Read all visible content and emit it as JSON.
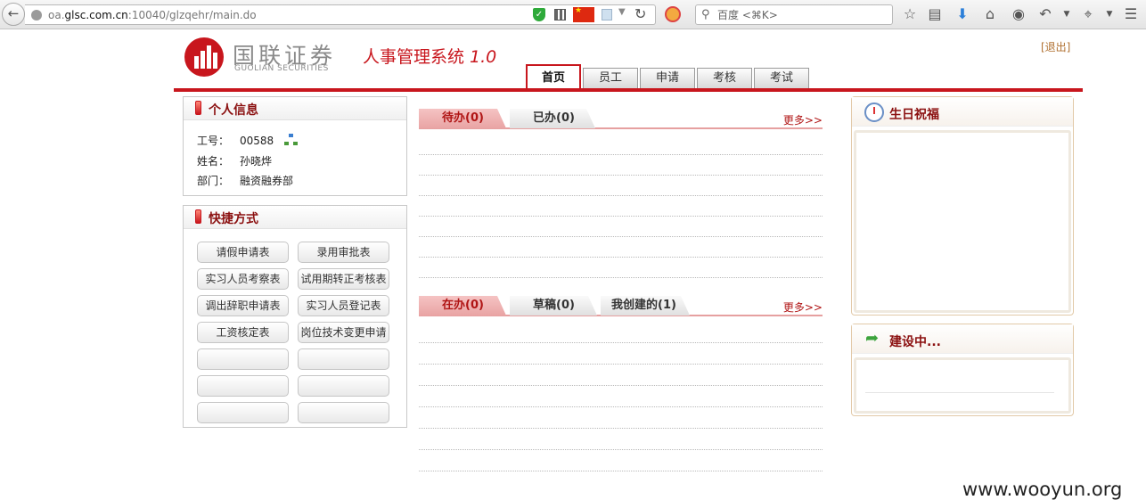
{
  "browser": {
    "url_prefix": "oa.",
    "url_domain": "glsc.com.cn",
    "url_suffix": ":10040/glzqehr/main.do",
    "search_placeholder": "百度 <⌘K>"
  },
  "header": {
    "logo_cn": "国联证券",
    "logo_en": "GUOLIAN SECURITIES",
    "system_title": "人事管理系统",
    "version": "1.0",
    "logout_label": "[退出]",
    "nav_tabs": [
      {
        "label": "首页",
        "active": true
      },
      {
        "label": "员工",
        "active": false
      },
      {
        "label": "申请",
        "active": false
      },
      {
        "label": "考核",
        "active": false
      },
      {
        "label": "考试",
        "active": false
      }
    ]
  },
  "personal_info": {
    "title": "个人信息",
    "rows": [
      {
        "label": "工号：",
        "value": "00588"
      },
      {
        "label": "姓名：",
        "value": "孙晓烨"
      },
      {
        "label": "部门：",
        "value": "融资融券部"
      }
    ]
  },
  "shortcuts": {
    "title": "快捷方式",
    "buttons": [
      "请假申请表",
      "录用审批表",
      "实习人员考察表",
      "试用期转正考核表",
      "调出辞职申请表",
      "实习人员登记表",
      "工资核定表",
      "岗位技术变更申请",
      "",
      "",
      "",
      "",
      "",
      ""
    ]
  },
  "tasks_top": {
    "tabs": [
      "待办(0)",
      "已办(0)"
    ],
    "more_label": "更多>>"
  },
  "tasks_bottom": {
    "tabs": [
      "在办(0)",
      "草稿(0)",
      "我创建的(1)"
    ],
    "more_label": "更多>>"
  },
  "birthday": {
    "title": "生日祝福"
  },
  "construction": {
    "title": "建设中..."
  },
  "watermark": "www.wooyun.org",
  "colors": {
    "brand_red": "#c8161d",
    "link_orange": "#b07030"
  }
}
